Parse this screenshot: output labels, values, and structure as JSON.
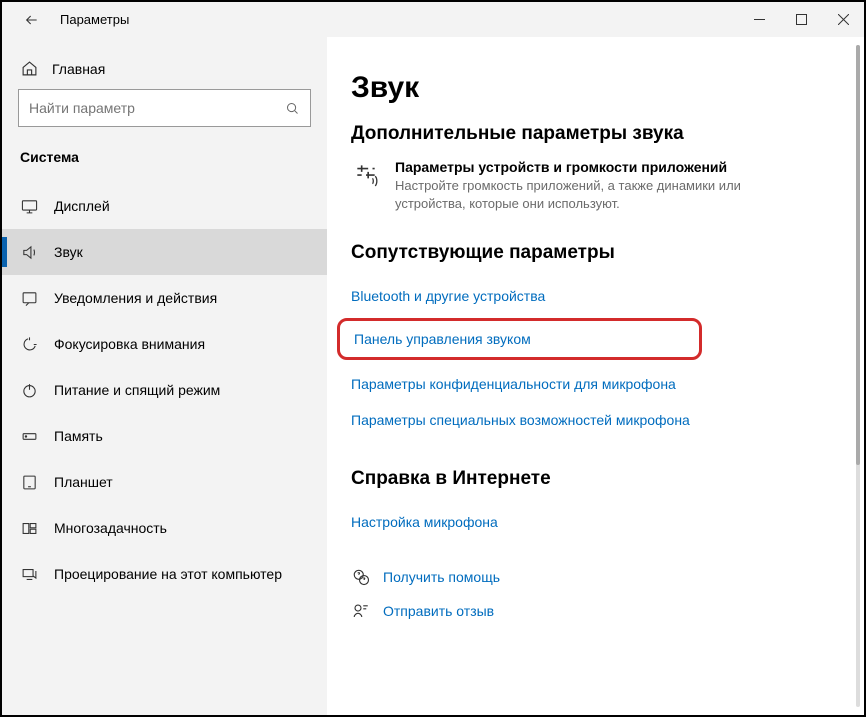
{
  "titlebar": {
    "title": "Параметры"
  },
  "sidebar": {
    "home_label": "Главная",
    "search_placeholder": "Найти параметр",
    "section": "Система",
    "items": [
      {
        "label": "Дисплей",
        "icon": "display-icon"
      },
      {
        "label": "Звук",
        "icon": "sound-icon"
      },
      {
        "label": "Уведомления и действия",
        "icon": "notifications-icon"
      },
      {
        "label": "Фокусировка внимания",
        "icon": "focus-icon"
      },
      {
        "label": "Питание и спящий режим",
        "icon": "power-icon"
      },
      {
        "label": "Память",
        "icon": "storage-icon"
      },
      {
        "label": "Планшет",
        "icon": "tablet-icon"
      },
      {
        "label": "Многозадачность",
        "icon": "multitask-icon"
      },
      {
        "label": "Проецирование на этот компьютер",
        "icon": "project-icon"
      }
    ]
  },
  "main": {
    "heading": "Звук",
    "advanced": {
      "title": "Дополнительные параметры звука",
      "device_title": "Параметры устройств и громкости приложений",
      "device_desc": "Настройте громкость приложений, а также динамики или устройства, которые они используют."
    },
    "related": {
      "title": "Сопутствующие параметры",
      "links": [
        "Bluetooth и другие устройства",
        "Панель управления звуком",
        "Параметры конфиденциальности для микрофона",
        "Параметры специальных возможностей микрофона"
      ]
    },
    "help": {
      "title": "Справка в Интернете",
      "link": "Настройка микрофона"
    },
    "footer": {
      "get_help": "Получить помощь",
      "feedback": "Отправить отзыв"
    }
  }
}
